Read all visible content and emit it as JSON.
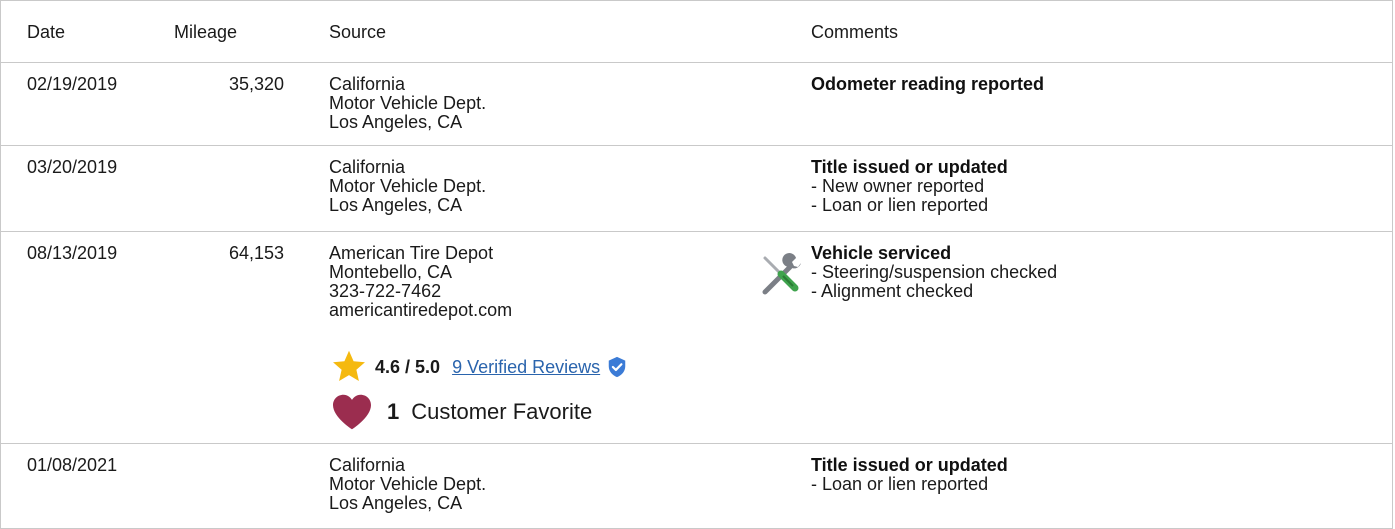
{
  "header": {
    "date": "Date",
    "mileage": "Mileage",
    "source": "Source",
    "comments": "Comments"
  },
  "rows": [
    {
      "date": "02/19/2019",
      "mileage": "35,320",
      "source": [
        "California",
        "Motor Vehicle Dept.",
        "Los Angeles, CA"
      ],
      "comment_title": "Odometer reading reported",
      "comment_details": []
    },
    {
      "date": "03/20/2019",
      "mileage": "",
      "source": [
        "California",
        "Motor Vehicle Dept.",
        "Los Angeles, CA"
      ],
      "comment_title": "Title issued or updated",
      "comment_details": [
        "- New owner reported",
        "- Loan or lien reported"
      ]
    },
    {
      "date": "08/13/2019",
      "mileage": "64,153",
      "source": [
        "American Tire Depot",
        "Montebello, CA",
        "323-722-7462",
        "americantiredepot.com"
      ],
      "comment_title": "Vehicle serviced",
      "comment_details": [
        "- Steering/suspension checked",
        "- Alignment checked"
      ],
      "service_icon": "wrench-screwdriver-icon",
      "rating": {
        "icon": "star-icon",
        "score": "4.6 / 5.0",
        "reviews_link": "9 Verified Reviews",
        "badge_icon": "verified-shield-icon"
      },
      "favorite": {
        "icon": "heart-icon",
        "count": "1",
        "label": "Customer Favorite"
      }
    },
    {
      "date": "01/08/2021",
      "mileage": "",
      "source": [
        "California",
        "Motor Vehicle Dept.",
        "Los Angeles, CA"
      ],
      "comment_title": "Title issued or updated",
      "comment_details": [
        "- Loan or lien reported"
      ]
    }
  ],
  "colors": {
    "link": "#2a64ad",
    "star": "#f5b90f",
    "heart": "#9b2d4f",
    "badge": "#3b7bd6",
    "border": "#c9c9c9"
  }
}
